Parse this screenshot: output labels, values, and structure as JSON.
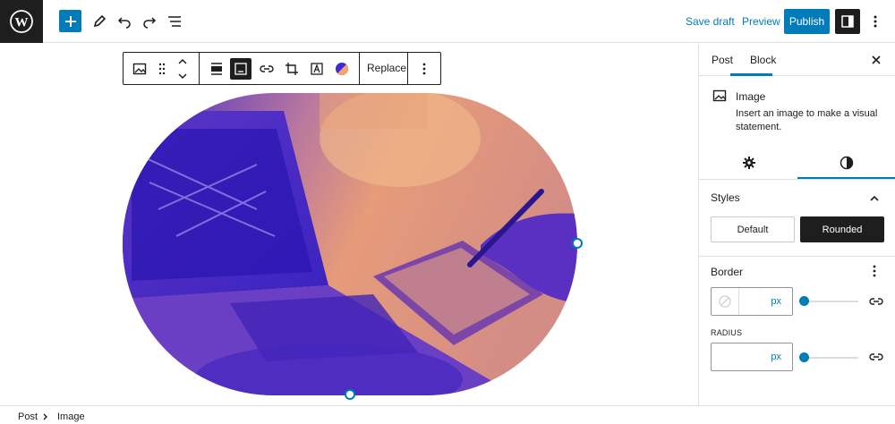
{
  "topbar": {
    "save_draft_label": "Save draft",
    "preview_label": "Preview",
    "publish_label": "Publish",
    "accent_color": "#007cba",
    "icons": [
      "wordpress-logo-icon",
      "plus-icon",
      "pencil-icon",
      "undo-icon",
      "redo-icon",
      "list-view-icon",
      "sidebar-icon",
      "more-vertical-icon"
    ]
  },
  "block_toolbar": {
    "replace_label": "Replace",
    "icons": [
      "image-icon",
      "drag-handle-icon",
      "move-up-icon",
      "move-down-icon",
      "align-icon",
      "caption-icon",
      "link-icon",
      "crop-icon",
      "text-overlay-icon",
      "duotone-icon",
      "more-vertical-icon"
    ]
  },
  "sidebar": {
    "tabs": [
      {
        "label": "Post",
        "active": false
      },
      {
        "label": "Block",
        "active": true
      }
    ],
    "block": {
      "title": "Image",
      "description": "Insert an image to make a visual statement."
    },
    "styles": {
      "heading": "Styles",
      "options": [
        {
          "label": "Default",
          "selected": false
        },
        {
          "label": "Rounded",
          "selected": true
        }
      ]
    },
    "border": {
      "heading": "Border",
      "unit": "px",
      "value": ""
    },
    "radius": {
      "label": "RADIUS",
      "unit": "px",
      "value": ""
    }
  },
  "breadcrumb": {
    "items": [
      "Post",
      "Image"
    ]
  }
}
